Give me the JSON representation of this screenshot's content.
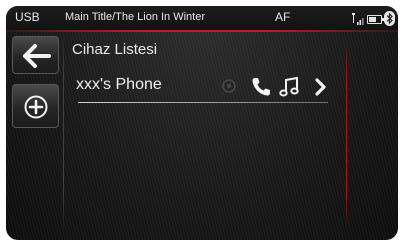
{
  "status_bar": {
    "source": "USB",
    "track": "Main Title/The Lion In Winter",
    "af": "AF",
    "icons": [
      "signal-icon",
      "battery-icon",
      "bluetooth-icon"
    ]
  },
  "sidebar": {
    "back_icon": "arrow-left-icon",
    "add_icon": "plus-circle-icon"
  },
  "list": {
    "title": "Cihaz Listesi",
    "items": [
      {
        "name": "xxx's Phone",
        "icons": [
          "connection-icon",
          "phone-icon",
          "music-note-icon",
          "chevron-right-icon"
        ]
      }
    ]
  },
  "colors": {
    "accent": "#c21d1d",
    "text": "#eeeeee",
    "background": "#161616"
  }
}
